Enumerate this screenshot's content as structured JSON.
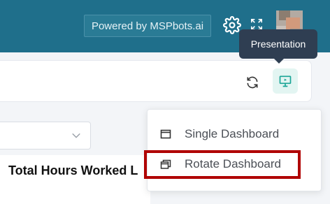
{
  "header": {
    "powered_by": "Powered by MSPbots.ai",
    "icons": {
      "settings": "gear-icon",
      "fullscreen": "expand-icon"
    },
    "colors": {
      "bar": "#1f6f8b"
    }
  },
  "toolbar": {
    "icons": {
      "refresh": "refresh-icon",
      "presentation": "presentation-icon"
    },
    "tooltip": "Presentation"
  },
  "menu": {
    "items": [
      {
        "label": "Single Dashboard",
        "icon": "window-icon"
      },
      {
        "label": "Rotate Dashboard",
        "icon": "stacked-windows-icon"
      }
    ],
    "highlight_color": "#b00000"
  },
  "content": {
    "section_title": "Total Hours Worked L"
  },
  "colors": {
    "accent": "#2aa79b",
    "tooltip_bg": "#2f3e52"
  }
}
